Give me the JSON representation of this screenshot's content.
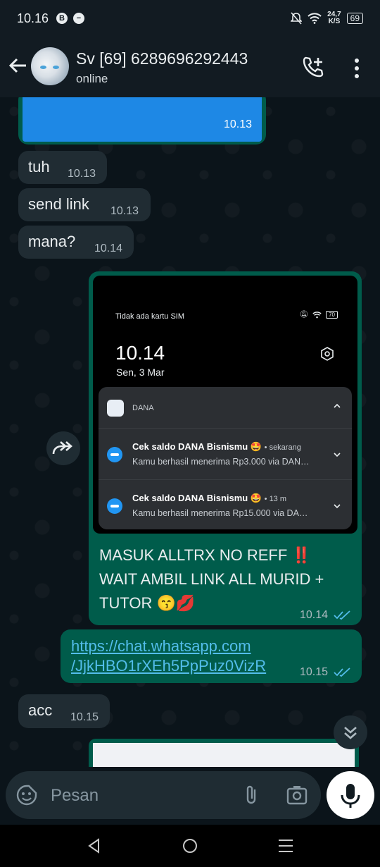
{
  "status_bar": {
    "time": "10.16",
    "icon1": "B",
    "net_speed_top": "24,7",
    "net_speed_bottom": "K/S",
    "battery": "69"
  },
  "header": {
    "contact_name": "Sv [69] 6289696292443",
    "status": "online"
  },
  "messages": [
    {
      "direction": "outgoing",
      "type": "image",
      "time": "10.13"
    },
    {
      "direction": "incoming",
      "text": "tuh",
      "time": "10.13"
    },
    {
      "direction": "incoming",
      "text": "send link",
      "time": "10.13"
    },
    {
      "direction": "incoming",
      "text": "mana?",
      "time": "10.14"
    },
    {
      "direction": "outgoing",
      "type": "image_with_caption",
      "caption_line1": "MASUK ALLTRX NO REFF",
      "caption_line1_emoji": "‼️",
      "caption_line2": "WAIT AMBIL LINK ALL MURID +",
      "caption_line3": "TUTOR 😙💋",
      "time": "10.14"
    },
    {
      "direction": "outgoing",
      "type": "link",
      "link_line1": "https://chat.whatsapp.com",
      "link_line2": "/JjkHBO1rXEh5PpPuz0VizR",
      "time": "10.15"
    },
    {
      "direction": "incoming",
      "text": "acc",
      "time": "10.15"
    }
  ],
  "screenshot_image": {
    "status": "Tidak ada kartu SIM",
    "battery": "70",
    "time": "10.14",
    "date": "Sen, 3 Mar",
    "app_name": "DANA",
    "notifications": [
      {
        "title": "Cek saldo DANA Bisnismu 🤩",
        "when": "• sekarang",
        "body": "Kamu berhasil menerima Rp3.000 via DAN…"
      },
      {
        "title": "Cek saldo DANA Bisnismu 🤩",
        "when": "• 13 m",
        "body": "Kamu berhasil menerima Rp15.000 via DA…"
      }
    ]
  },
  "composer": {
    "placeholder": "Pesan"
  },
  "colors": {
    "incoming_bubble": "#202c33",
    "outgoing_bubble": "#005c4b",
    "link": "#53bdeb",
    "read_ticks": "#53bdeb",
    "background": "#0b141a"
  }
}
